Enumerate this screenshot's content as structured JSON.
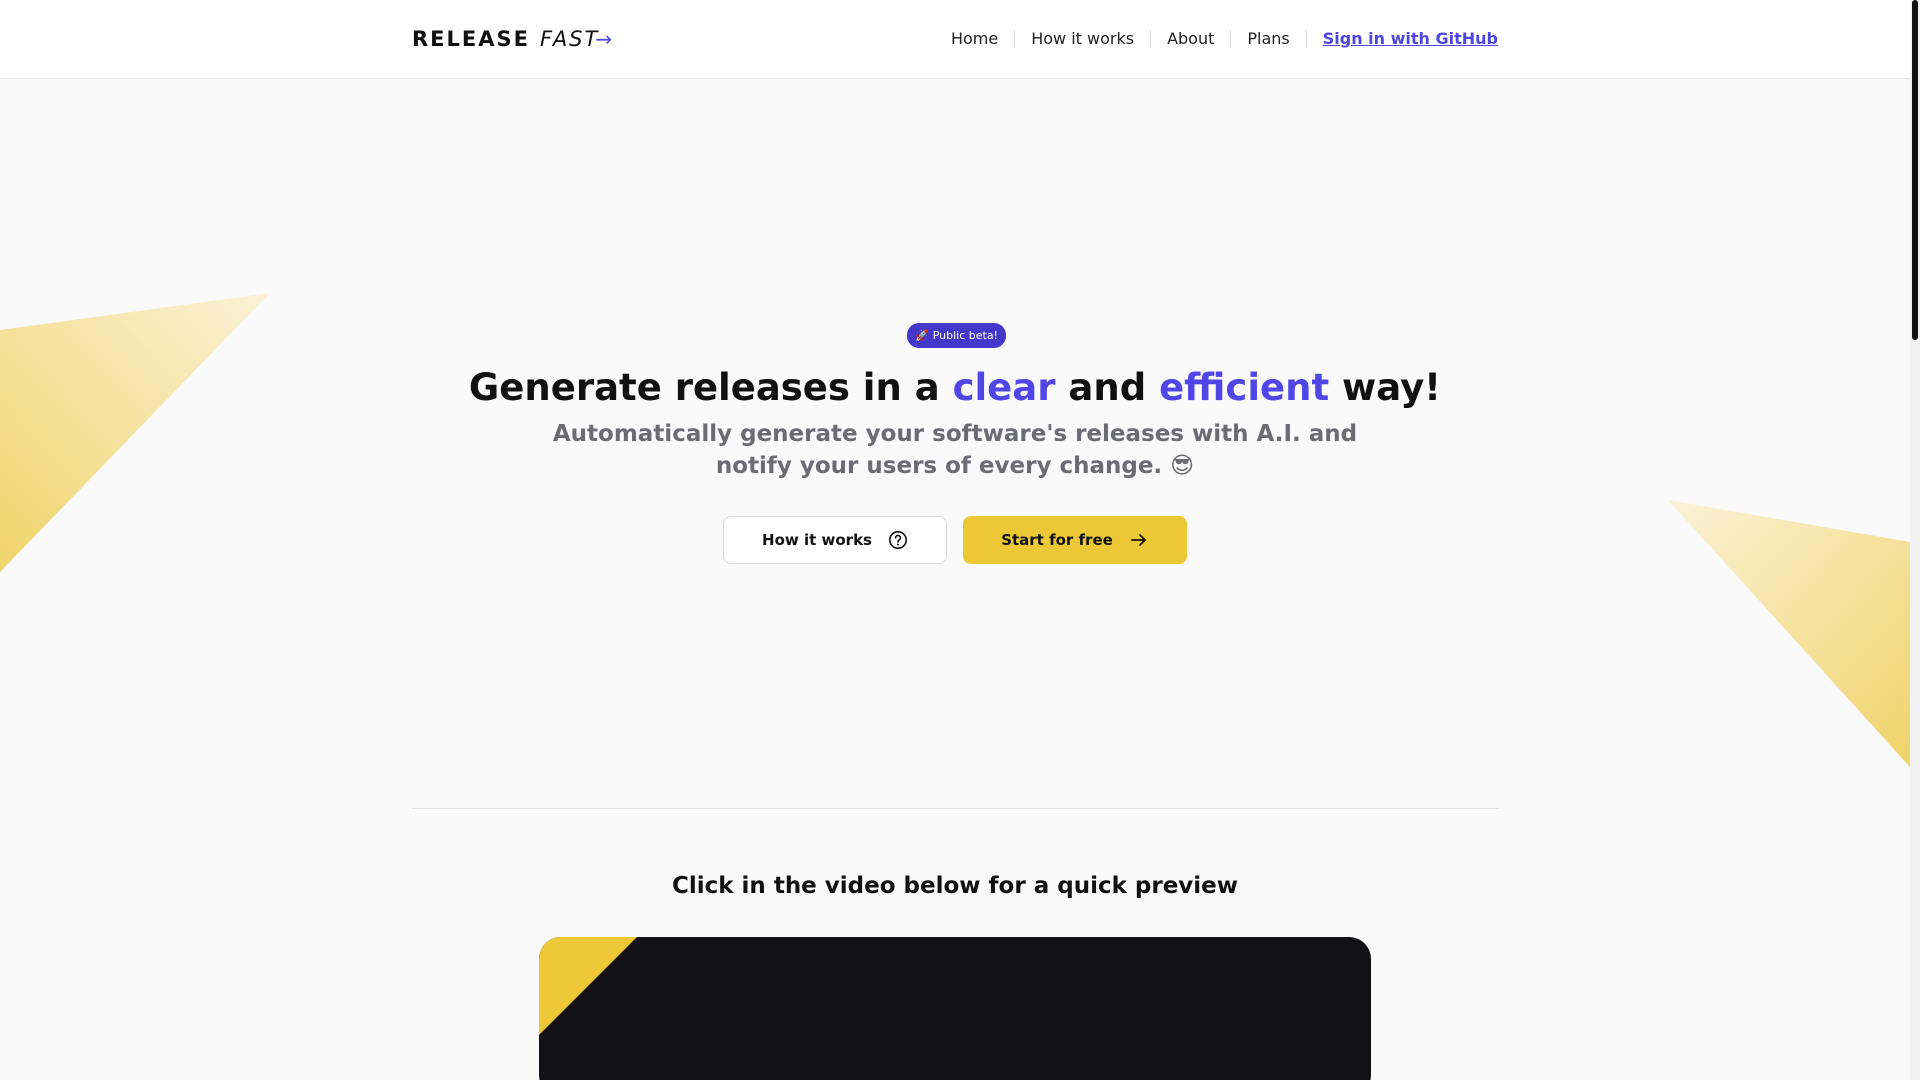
{
  "header": {
    "logo_release": "RELEASE",
    "logo_fast": "FAST",
    "nav": {
      "home": "Home",
      "how_it_works": "How it works",
      "about": "About",
      "plans": "Plans",
      "sign_in": "Sign in with GitHub"
    }
  },
  "hero": {
    "badge_icon": "🚀",
    "badge_text": "Public beta!",
    "title_part1": "Generate releases in a ",
    "title_accent1": "clear",
    "title_part2": " and ",
    "title_accent2": "efficient",
    "title_part3": " way!",
    "subtitle": "Automatically generate your software's releases with A.I. and notify your users of every change. 😎",
    "secondary_button": "How it works",
    "primary_button": "Start for free"
  },
  "preview": {
    "title": "Click in the video below for a quick preview"
  },
  "colors": {
    "accent": "#4f46e5",
    "primary_button": "#ecc836",
    "decoration": "#f0d36a",
    "video_bg": "#111116"
  },
  "icons": {
    "badge": "rocket-icon",
    "secondary_button": "question-circle-icon",
    "primary_button": "arrow-right-icon",
    "logo": "arrow-right-icon"
  }
}
